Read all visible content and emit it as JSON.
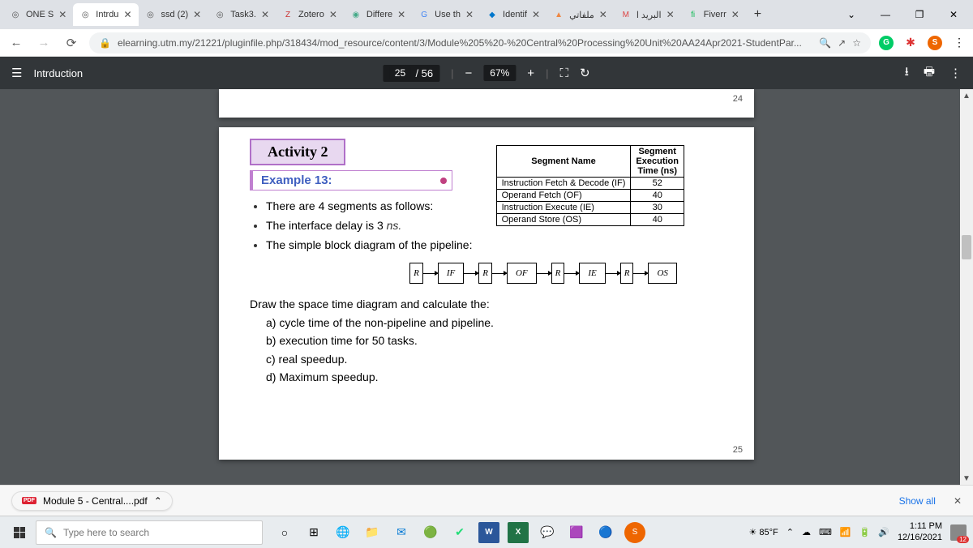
{
  "tabs": [
    {
      "favicon": "◎",
      "color": "#555",
      "title": "ONE S"
    },
    {
      "favicon": "◎",
      "color": "#555",
      "title": "Intrdu"
    },
    {
      "favicon": "◎",
      "color": "#555",
      "title": "ssd (2)"
    },
    {
      "favicon": "◎",
      "color": "#555",
      "title": "Task3."
    },
    {
      "favicon": "Z",
      "color": "#c33",
      "title": "Zotero"
    },
    {
      "favicon": "◉",
      "color": "#4a8",
      "title": "Differe"
    },
    {
      "favicon": "G",
      "color": "#4285f4",
      "title": "Use th"
    },
    {
      "favicon": "◆",
      "color": "#07c",
      "title": "Identif"
    },
    {
      "favicon": "▲",
      "color": "#e84",
      "title": "ملفاتي"
    },
    {
      "favicon": "M",
      "color": "#d44",
      "title": "البريد ا"
    },
    {
      "favicon": "fi",
      "color": "#1b5",
      "title": "Fiverr"
    }
  ],
  "url": "elearning.utm.my/21221/pluginfile.php/318434/mod_resource/content/3/Module%205%20-%20Central%20Processing%20Unit%20AA24Apr2021-StudentPar...",
  "pdf": {
    "title": "Intrduction",
    "page_current": "25",
    "page_total": "/ 56",
    "zoom": "67%",
    "page_top_num": "24",
    "page_bot_num": "25"
  },
  "doc": {
    "activity": "Activity 2",
    "example": "Example 13:",
    "bullet1": "There are 4 segments as follows:",
    "bullet2": "The interface delay is 3 ",
    "bullet2_unit": "ns.",
    "bullet3": "The simple block diagram of the pipeline:",
    "table": {
      "h1": "Segment Name",
      "h2a": "Segment",
      "h2b": "Execution",
      "h2c": "Time (ns)",
      "rows": [
        {
          "name": "Instruction Fetch & Decode (IF)",
          "val": "52"
        },
        {
          "name": "Operand Fetch (OF)",
          "val": "40"
        },
        {
          "name": "Instruction Execute (IE)",
          "val": "30"
        },
        {
          "name": "Operand Store (OS)",
          "val": "40"
        }
      ]
    },
    "pipeline": [
      "R",
      "IF",
      "R",
      "OF",
      "R",
      "IE",
      "R",
      "OS"
    ],
    "q_lead": "Draw the space time diagram and calculate the:",
    "qa": "a)  cycle time of the non-pipeline and pipeline.",
    "qb": "b)  execution time for 50 tasks.",
    "qc": "c)  real speedup.",
    "qd": "d)  Maximum speedup."
  },
  "download": {
    "file": "Module 5 - Central....pdf",
    "showall": "Show all"
  },
  "taskbar": {
    "search_ph": "Type here to search",
    "temp": "85°F",
    "time": "1:11 PM",
    "date": "12/16/2021",
    "notif_count": "12"
  }
}
